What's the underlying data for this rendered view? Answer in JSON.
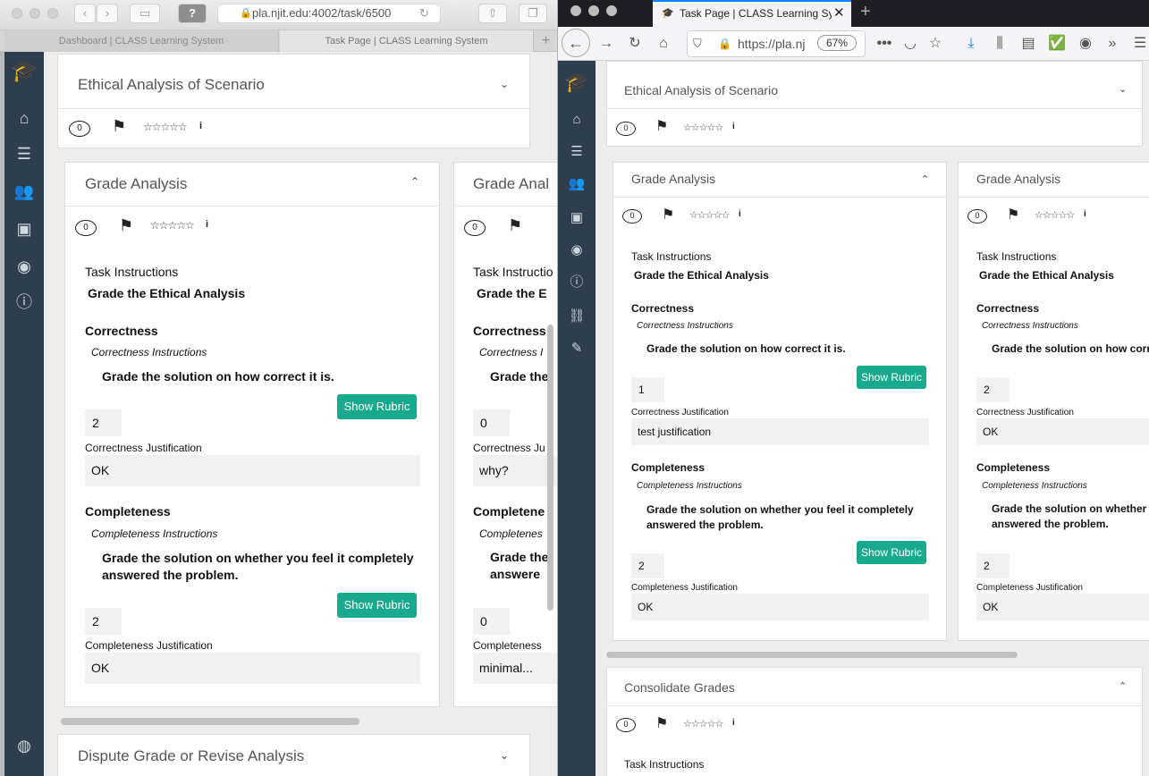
{
  "safari": {
    "url": "pla.njit.edu:4002/task/6500",
    "tabs": [
      "Dashboard | CLASS Learning System",
      "Task Page | CLASS Learning System"
    ],
    "new_tab": "+"
  },
  "firefox": {
    "tab_title": "Task Page | CLASS Learning Sy",
    "url": "https://pla.nj",
    "zoom": "67%",
    "new_tab": "+"
  },
  "common": {
    "ethical_title": "Ethical Analysis of Scenario",
    "grade_title": "Grade Analysis",
    "dispute_title": "Dispute Grade or Revise Analysis",
    "consolidate_title": "Consolidate Grades",
    "comment_count": "0",
    "stars": "☆☆☆☆☆",
    "info_icon": "i",
    "task_instructions_label": "Task Instructions",
    "task_instructions_text": "Grade the Ethical Analysis",
    "correctness_label": "Correctness",
    "correctness_instructions_label": "Correctness Instructions",
    "correctness_instructions_text": "Grade the solution on how correct it is.",
    "correctness_justification_label": "Correctness Justification",
    "completeness_label": "Completeness",
    "completeness_instructions_label": "Completeness Instructions",
    "completeness_instructions_text": "Grade the solution on whether you feel it completely answered the problem.",
    "completeness_justification_label": "Completeness Justification",
    "show_rubric": "Show Rubric"
  },
  "left_cards": [
    {
      "correctness_value": "2",
      "correctness_justification": "OK",
      "completeness_value": "2",
      "completeness_justification": "OK"
    },
    {
      "correctness_value": "0",
      "correctness_justification": "why?",
      "completeness_value": "0",
      "completeness_justification": "minimal..."
    }
  ],
  "right_cards": [
    {
      "correctness_value": "1",
      "correctness_justification": "test justification",
      "completeness_value": "2",
      "completeness_justification": "OK"
    },
    {
      "correctness_value": "2",
      "correctness_justification": "OK",
      "completeness_value": "2",
      "completeness_justification": "OK"
    }
  ],
  "left_card2_fragments": {
    "grade_title": "Grade Anal",
    "task_instructions_label": "Task Instructio",
    "task_instructions_text": "Grade the E",
    "correctness_label": "Correctness",
    "correctness_instructions_label": "Correctness I",
    "correctness_instructions_text": "Grade the",
    "correctness_justification_label": "Correctness Ju",
    "completeness_label": "Completene",
    "completeness_instructions_label": "Completenes",
    "completeness_instructions_line1": "Grade the",
    "completeness_instructions_line2": "answere",
    "completeness_justification_label": "Completeness"
  },
  "right_card2_fragments": {
    "correctness_instructions_text": "Grade the solution on how corr",
    "completeness_instructions_line1": "Grade the solution on whether",
    "completeness_instructions_line2": "answered the problem."
  },
  "right_consolidate_task_label": "Task Instructions"
}
